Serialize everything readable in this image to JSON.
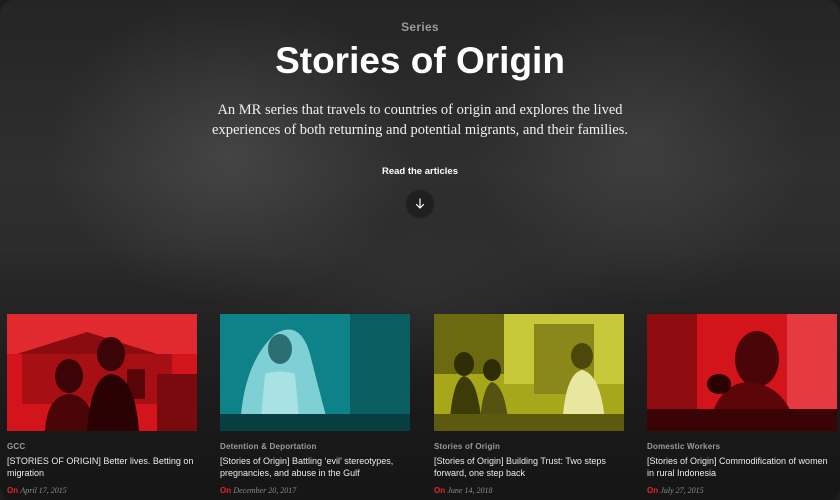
{
  "hero": {
    "eyebrow": "Series",
    "title": "Stories of Origin",
    "description": "An MR series that travels to countries of origin and explores the lived experiences of both returning and potential migrants, and their families.",
    "read_label": "Read the articles",
    "arrow_icon": "arrow-down-icon"
  },
  "colors": {
    "accent_red": "#e8242a",
    "tint_red": "#d4141b",
    "tint_teal": "#0f8f95",
    "tint_olive": "#a8a61a"
  },
  "cards": [
    {
      "category": "GCC",
      "title": "[STORIES OF ORIGIN] Better lives. Betting on migration",
      "on_label": "On",
      "date": "April 17, 2015"
    },
    {
      "category": "Detention & Deportation",
      "title": "[Stories of Origin] Battling ‘evil’ stereotypes, pregnancies, and abuse in the Gulf",
      "on_label": "On",
      "date": "December 20, 2017"
    },
    {
      "category": "Stories of Origin",
      "title": "[Stories of Origin] Building Trust: Two steps forward, one step back",
      "on_label": "On",
      "date": "June 14, 2018"
    },
    {
      "category": "Domestic Workers",
      "title": "[Stories of Origin] Commodification of women in rural Indonesia",
      "on_label": "On",
      "date": "July 27, 2015"
    }
  ]
}
